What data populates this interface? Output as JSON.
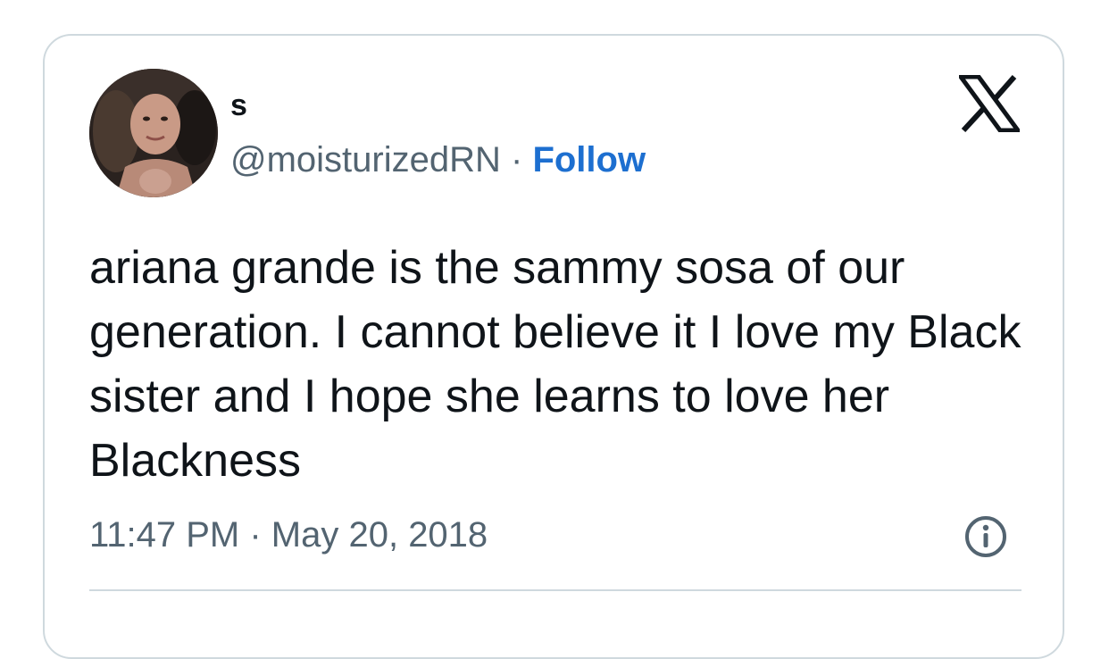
{
  "user": {
    "display_name": "s",
    "handle": "@moisturizedRN",
    "separator": " · ",
    "follow_label": "Follow"
  },
  "tweet": {
    "text": "ariana grande is the sammy sosa of our generation. I cannot believe it I love my Black sister and I hope she learns to love her Blackness",
    "timestamp": "11:47 PM · May 20, 2018"
  },
  "icons": {
    "brand": "x-logo-icon",
    "info": "info-icon"
  },
  "colors": {
    "text_primary": "#0f1419",
    "text_secondary": "#536471",
    "link": "#1d6fd0",
    "border": "#cfd9de"
  }
}
